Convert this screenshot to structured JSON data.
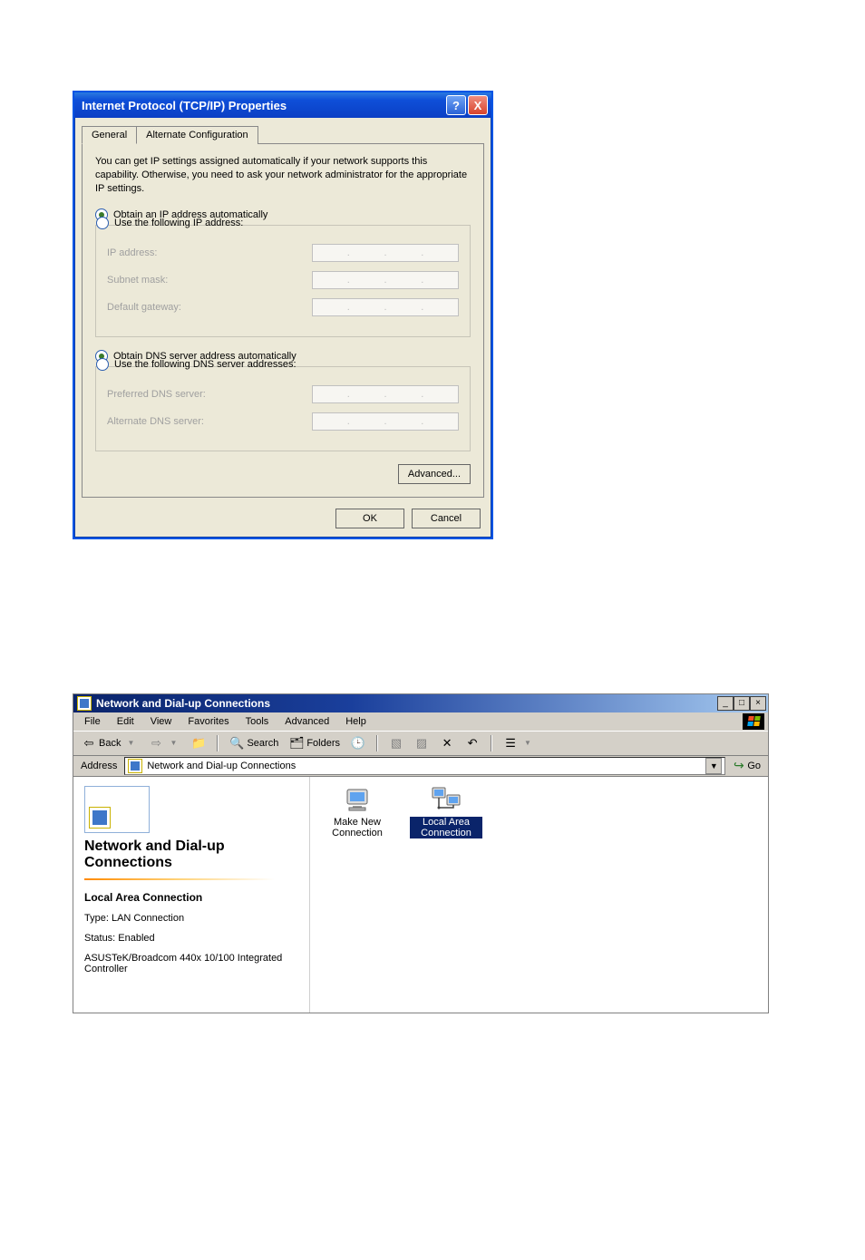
{
  "dialog1": {
    "title": "Internet Protocol (TCP/IP) Properties",
    "help_btn": "?",
    "close_btn": "X",
    "tabs": {
      "general": "General",
      "alt": "Alternate Configuration"
    },
    "description": "You can get IP settings assigned automatically if your network supports this capability. Otherwise, you need to ask your network administrator for the appropriate IP settings.",
    "radio_obtain_ip": "Obtain an IP address automatically",
    "radio_use_ip": "Use the following IP address:",
    "lbl_ip": "IP address:",
    "lbl_subnet": "Subnet mask:",
    "lbl_gateway": "Default gateway:",
    "radio_obtain_dns": "Obtain DNS server address automatically",
    "radio_use_dns": "Use the following DNS server addresses:",
    "lbl_pref_dns": "Preferred DNS server:",
    "lbl_alt_dns": "Alternate DNS server:",
    "btn_advanced": "Advanced...",
    "btn_ok": "OK",
    "btn_cancel": "Cancel"
  },
  "win2": {
    "title": "Network and Dial-up Connections",
    "menu": {
      "file": "File",
      "edit": "Edit",
      "view": "View",
      "fav": "Favorites",
      "tools": "Tools",
      "adv": "Advanced",
      "help": "Help"
    },
    "toolbar": {
      "back": "Back",
      "search": "Search",
      "folders": "Folders"
    },
    "addressbar": {
      "label": "Address",
      "value": "Network and Dial-up Connections",
      "go": "Go"
    },
    "left": {
      "heading": "Network and Dial-up Connections",
      "sub": "Local Area Connection",
      "type": "Type: LAN Connection",
      "status": "Status: Enabled",
      "adapter": "ASUSTeK/Broadcom 440x 10/100 Integrated Controller"
    },
    "items": {
      "make_new": "Make New Connection",
      "lac": "Local Area Connection"
    }
  }
}
